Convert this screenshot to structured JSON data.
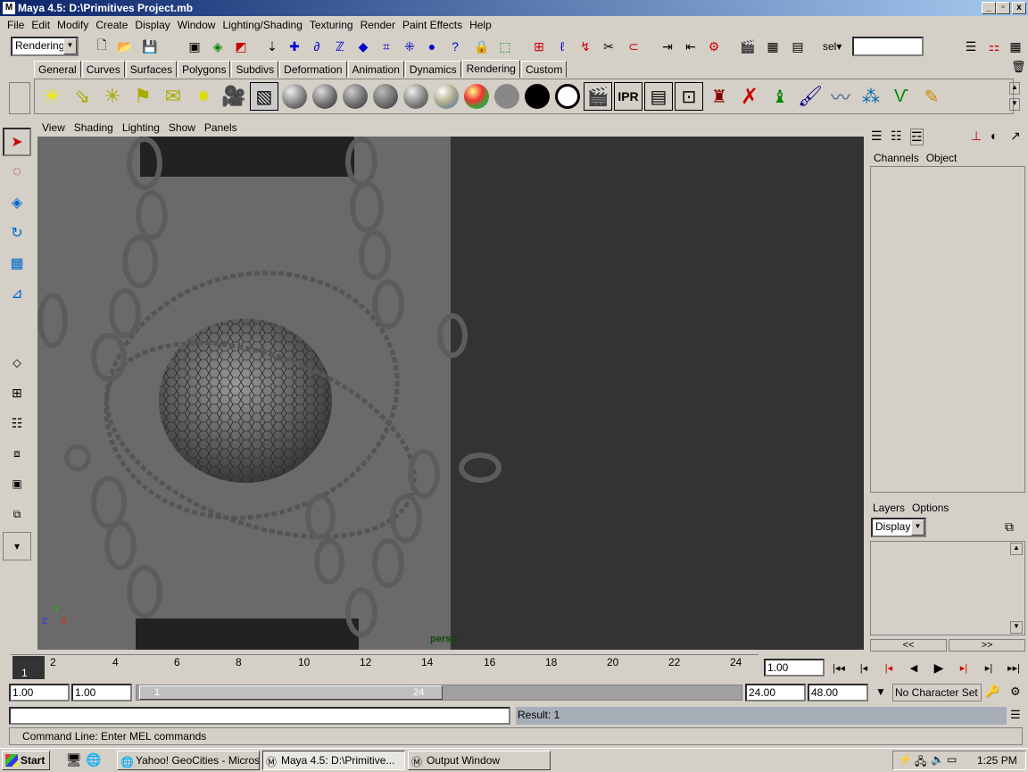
{
  "window": {
    "title": "Maya 4.5: D:\\Primitives Project.mb",
    "icon": "maya-icon",
    "buttons": [
      "minimize-icon",
      "restore-icon",
      "close-icon"
    ]
  },
  "menu": [
    "File",
    "Edit",
    "Modify",
    "Create",
    "Display",
    "Window",
    "Lighting/Shading",
    "Texturing",
    "Render",
    "Paint Effects",
    "Help"
  ],
  "toolbar": {
    "menu_set": "Rendering",
    "sel_label": "sel▾",
    "quick_select_value": ""
  },
  "shelf_tabs": [
    "General",
    "Curves",
    "Surfaces",
    "Polygons",
    "Subdivs",
    "Deformation",
    "Animation",
    "Dynamics",
    "Rendering",
    "Custom"
  ],
  "active_shelf_tab": "Rendering",
  "viewport": {
    "menus": [
      "View",
      "Shading",
      "Lighting",
      "Show",
      "Panels"
    ],
    "camera_label": "persp",
    "axis_y": "Y",
    "axis_x": "X",
    "axis_z": "Z"
  },
  "channel_box": {
    "menus": [
      "Channels",
      "Object"
    ]
  },
  "layers": {
    "menus": [
      "Layers",
      "Options"
    ],
    "display": "Display",
    "prev": "<<",
    "next": ">>"
  },
  "timeline": {
    "current_frame": "1",
    "ticks": [
      "2",
      "4",
      "6",
      "8",
      "10",
      "12",
      "14",
      "16",
      "18",
      "20",
      "22",
      "24"
    ],
    "current_time": "1.00"
  },
  "range": {
    "start": "1.00",
    "playback_start": "1.00",
    "slider_start": "1",
    "slider_end": "24",
    "playback_end": "24.00",
    "end": "48.00",
    "character_set": "No Character Set"
  },
  "command": {
    "input": "",
    "result": "Result: 1",
    "help_line": "Command Line: Enter MEL commands"
  },
  "taskbar": {
    "start": "Start",
    "tasks": [
      "Yahoo! GeoCities - Micros...",
      "Maya 4.5: D:\\Primitive...",
      "Output Window"
    ],
    "clock": "1:25 PM"
  },
  "colors": {
    "titlebar": "#0a246a",
    "chrome": "#d4d0c8",
    "viewport_bg": "#333333",
    "viewport_panel": "#666666"
  }
}
